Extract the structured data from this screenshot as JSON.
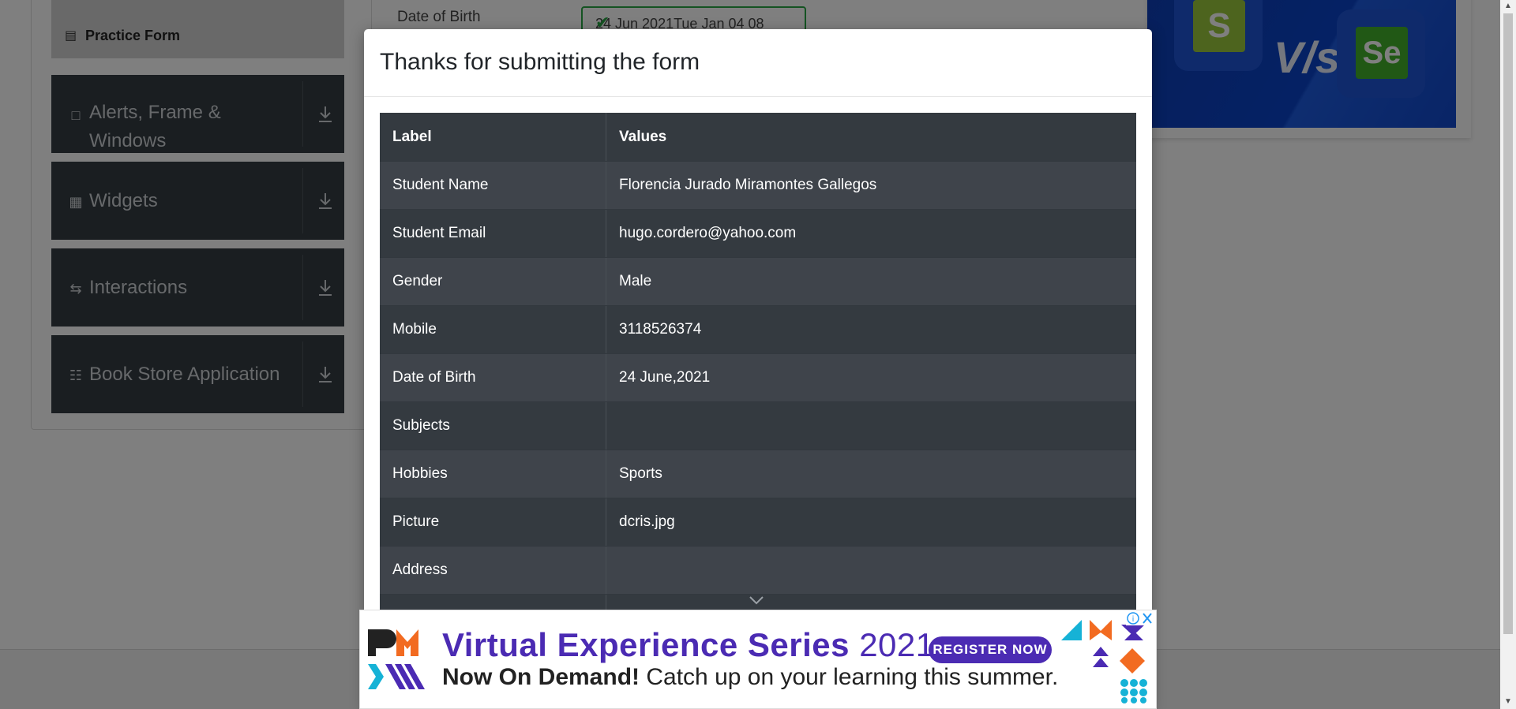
{
  "sidebar": {
    "practice_form": "Practice Form",
    "items": [
      {
        "label": "Alerts, Frame &",
        "label2": "Windows",
        "icon": "window-icon"
      },
      {
        "label": "Widgets",
        "icon": "widgets-icon"
      },
      {
        "label": "Interactions",
        "icon": "interactions-icon"
      },
      {
        "label": "Book Store Application",
        "icon": "books-icon"
      }
    ]
  },
  "form": {
    "dob_label": "Date of Birth",
    "dob_value": "24 Jun 2021Tue Jan 04 08"
  },
  "banner": {
    "vs_text": "V/s",
    "left_mark": "S",
    "right_mark": "Se"
  },
  "modal": {
    "title": "Thanks for submitting the form",
    "table": {
      "headers": [
        "Label",
        "Values"
      ],
      "rows": [
        {
          "label": "Student Name",
          "value": "Florencia Jurado Miramontes Gallegos"
        },
        {
          "label": "Student Email",
          "value": "hugo.cordero@yahoo.com"
        },
        {
          "label": "Gender",
          "value": "Male"
        },
        {
          "label": "Mobile",
          "value": "3118526374"
        },
        {
          "label": "Date of Birth",
          "value": "24 June,2021"
        },
        {
          "label": "Subjects",
          "value": ""
        },
        {
          "label": "Hobbies",
          "value": "Sports"
        },
        {
          "label": "Picture",
          "value": "dcris.jpg"
        },
        {
          "label": "Address",
          "value": ""
        }
      ]
    }
  },
  "ad": {
    "headline": "Virtual Experience Series",
    "year": "2021",
    "cta": "REGISTER NOW",
    "subline_bold": "Now On Demand!",
    "subline_rest": "Catch up on your learning this summer.",
    "colors": {
      "purple": "#4b2bb3",
      "cyan": "#16b2d6",
      "orange": "#f26b21"
    }
  }
}
